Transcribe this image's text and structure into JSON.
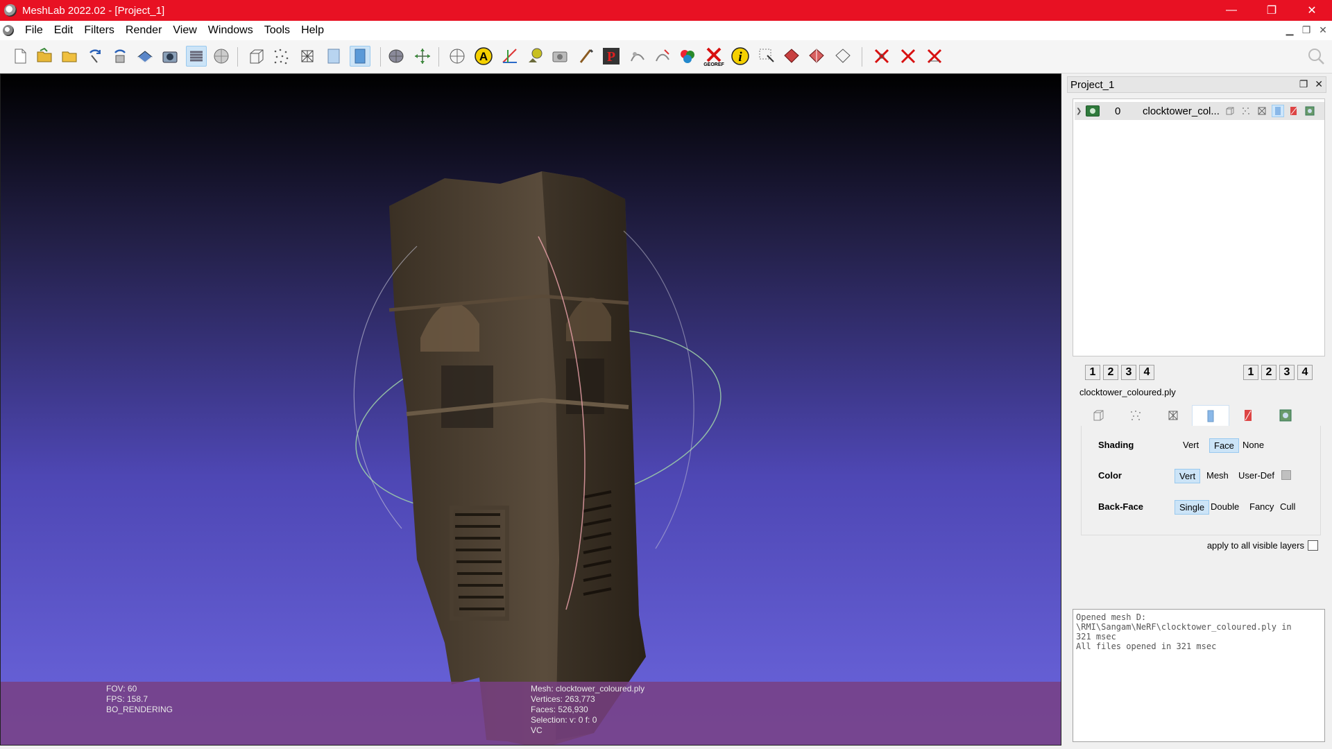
{
  "window": {
    "title": "MeshLab 2022.02 - [Project_1]"
  },
  "menu": [
    "File",
    "Edit",
    "Filters",
    "Render",
    "View",
    "Windows",
    "Tools",
    "Help"
  ],
  "toolbar": {
    "tools": [
      "new-project",
      "open-project",
      "import-mesh",
      "reload",
      "reload-all",
      "export-mesh",
      "snapshot",
      "show-layer-dialog",
      "show-raster",
      "bounding-box",
      "points",
      "wireframe",
      "flat-lines",
      "flat",
      "smooth",
      "light-on",
      "reset-trackball",
      "measure",
      "annotate",
      "pick-points",
      "align",
      "raster-align",
      "paint",
      "pick-p",
      "z-painting",
      "fill-select",
      "mutual-info",
      "georef",
      "info",
      "select-vertices",
      "select-faces",
      "select-connected",
      "select-none",
      "delete-vertices",
      "delete-faces",
      "delete-faces-vertices"
    ],
    "search_icon": "search-icon"
  },
  "viewport": {
    "info_left": {
      "fov": "FOV: 60",
      "fps": "FPS:   158.7",
      "mode": "BO_RENDERING"
    },
    "info_mid": {
      "mesh": "Mesh: clocktower_coloured.ply",
      "vertices": "Vertices: 263,773",
      "faces": "Faces: 526,930",
      "selection": "Selection: v: 0 f: 0",
      "vc": "VC"
    },
    "colors": {
      "bg_top": "#000000",
      "bg_bottom": "#6c66de",
      "info_bar": "#784082"
    }
  },
  "panel": {
    "title": "Project_1",
    "layers": [
      {
        "id": "0",
        "name": "clocktower_col..."
      }
    ],
    "left_nums": [
      "1",
      "2",
      "3",
      "4"
    ],
    "right_nums": [
      "1",
      "2",
      "3",
      "4"
    ],
    "mesh_name": "clocktower_coloured.ply",
    "render": {
      "shading": {
        "label": "Shading",
        "options": [
          "Vert",
          "Face",
          "None"
        ],
        "selected": "Face"
      },
      "color": {
        "label": "Color",
        "options": [
          "Vert",
          "Mesh",
          "User-Def"
        ],
        "selected": "Vert"
      },
      "backface": {
        "label": "Back-Face",
        "options": [
          "Single",
          "Double",
          "Fancy",
          "Cull"
        ],
        "selected": "Single"
      }
    },
    "apply_all": "apply to all visible layers",
    "log": "Opened mesh D:\n\\RMI\\Sangam\\NeRF\\clocktower_coloured.ply in\n321 msec\nAll files opened in 321 msec"
  }
}
